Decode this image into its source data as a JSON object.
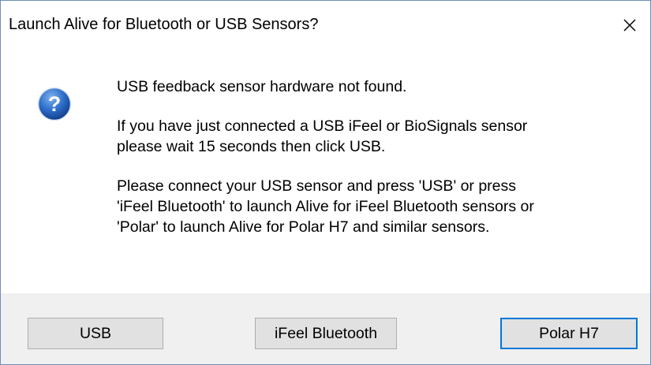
{
  "dialog": {
    "title": "Launch Alive for Bluetooth or USB Sensors?",
    "close_glyph": "✕",
    "icon": "question-icon",
    "icon_glyph": "?",
    "messages": [
      "USB feedback sensor hardware not found.",
      "If you have just connected a USB iFeel or BioSignals sensor\nplease wait 15 seconds then click USB.",
      "Please connect your USB sensor and press 'USB' or press\n'iFeel Bluetooth' to launch Alive for iFeel Bluetooth sensors or\n'Polar' to launch Alive for Polar H7 and similar sensors."
    ],
    "buttons": {
      "usb": "USB",
      "ifeel": "iFeel Bluetooth",
      "polar": "Polar H7"
    },
    "default_button": "polar",
    "colors": {
      "accent": "#0078d7",
      "footer": "#f0f0f0",
      "button": "#e1e1e1",
      "icon": "#1c5fb8"
    }
  }
}
